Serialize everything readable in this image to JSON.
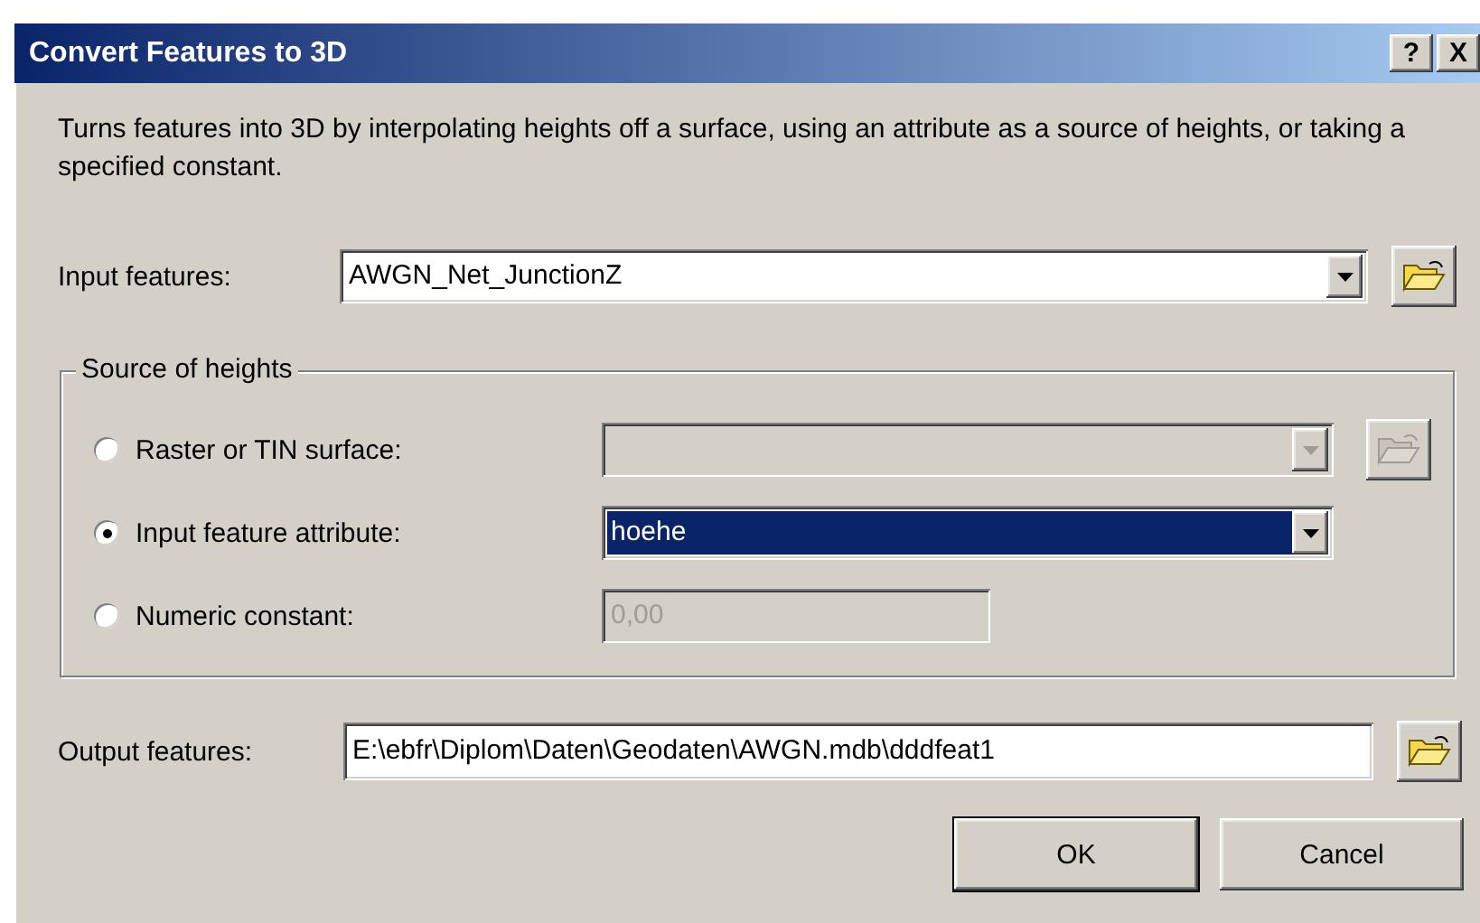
{
  "window": {
    "title": "Convert Features to 3D",
    "title_buttons": [
      "?",
      "X"
    ]
  },
  "description": "Turns features into 3D by interpolating heights off a surface, using an attribute as a source of heights, or taking a specified constant.",
  "input_features": {
    "label": "Input features:",
    "value": "AWGN_Net_JunctionZ"
  },
  "source_of_heights": {
    "legend": "Source of heights",
    "options": [
      {
        "label": "Raster or TIN surface:",
        "selected": false,
        "kind": "combo",
        "disabled": true,
        "focused": false,
        "browse": true
      },
      {
        "label": "Input feature attribute:",
        "selected": true,
        "kind": "combo",
        "value": "hoehe",
        "disabled": false,
        "focused": true,
        "browse": false
      },
      {
        "label": "Numeric constant:",
        "selected": false,
        "kind": "text",
        "value": "0,00",
        "disabled": true,
        "focused": false,
        "browse": false
      }
    ]
  },
  "output_features": {
    "label": "Output features:",
    "value": "E:\\ebfr\\Diplom\\Daten\\Geodaten\\AWGN.mdb\\dddfeat1"
  },
  "buttons": [
    "OK",
    "Cancel"
  ]
}
